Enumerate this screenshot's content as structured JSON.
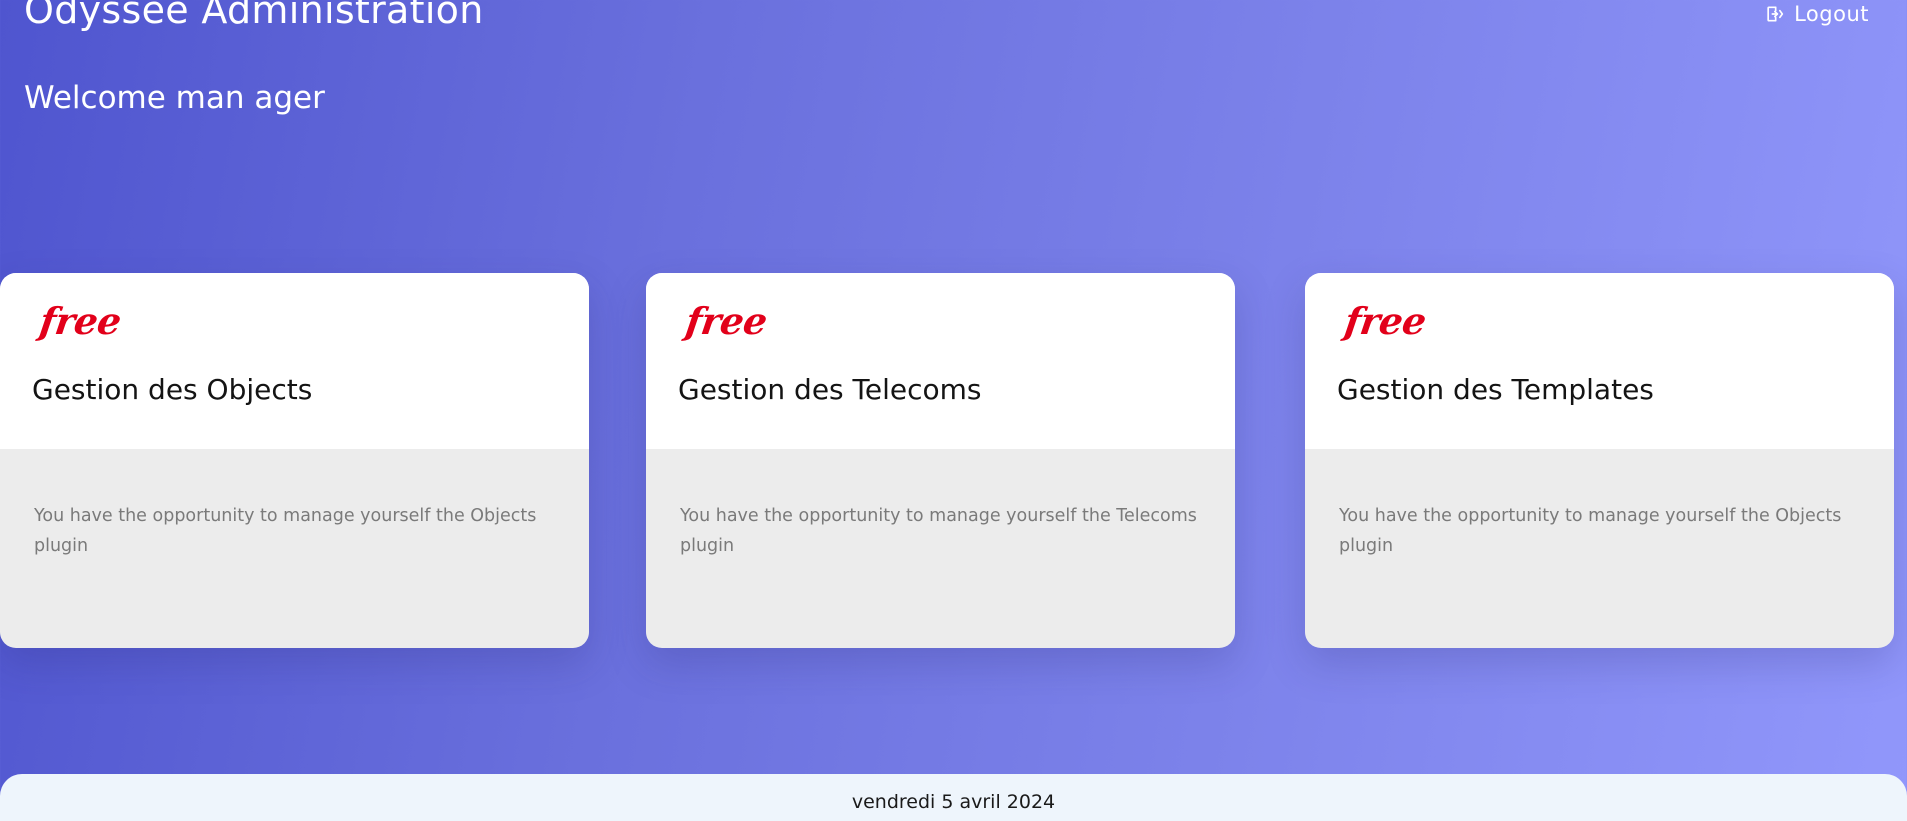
{
  "header": {
    "app_title": "Odyssée Administration",
    "logout_label": "Logout",
    "logout_icon": "logout-icon"
  },
  "welcome": {
    "text": "Welcome man ager"
  },
  "cards": [
    {
      "logo": "free",
      "title": "Gestion des Objects",
      "description": "You have the opportunity to manage yourself the Objects plugin"
    },
    {
      "logo": "free",
      "title": "Gestion des Telecoms",
      "description": "You have the opportunity to manage yourself the Telecoms plugin"
    },
    {
      "logo": "free",
      "title": "Gestion des Templates",
      "description": "You have the opportunity to manage yourself the Objects plugin"
    }
  ],
  "footer": {
    "date": "vendredi 5 avril 2024"
  },
  "colors": {
    "gradient_start": "#4f55cf",
    "gradient_end": "#9197fb",
    "logo_red": "#e2001a",
    "card_bottom": "#ececec",
    "footer_bg": "#eef5fc"
  }
}
